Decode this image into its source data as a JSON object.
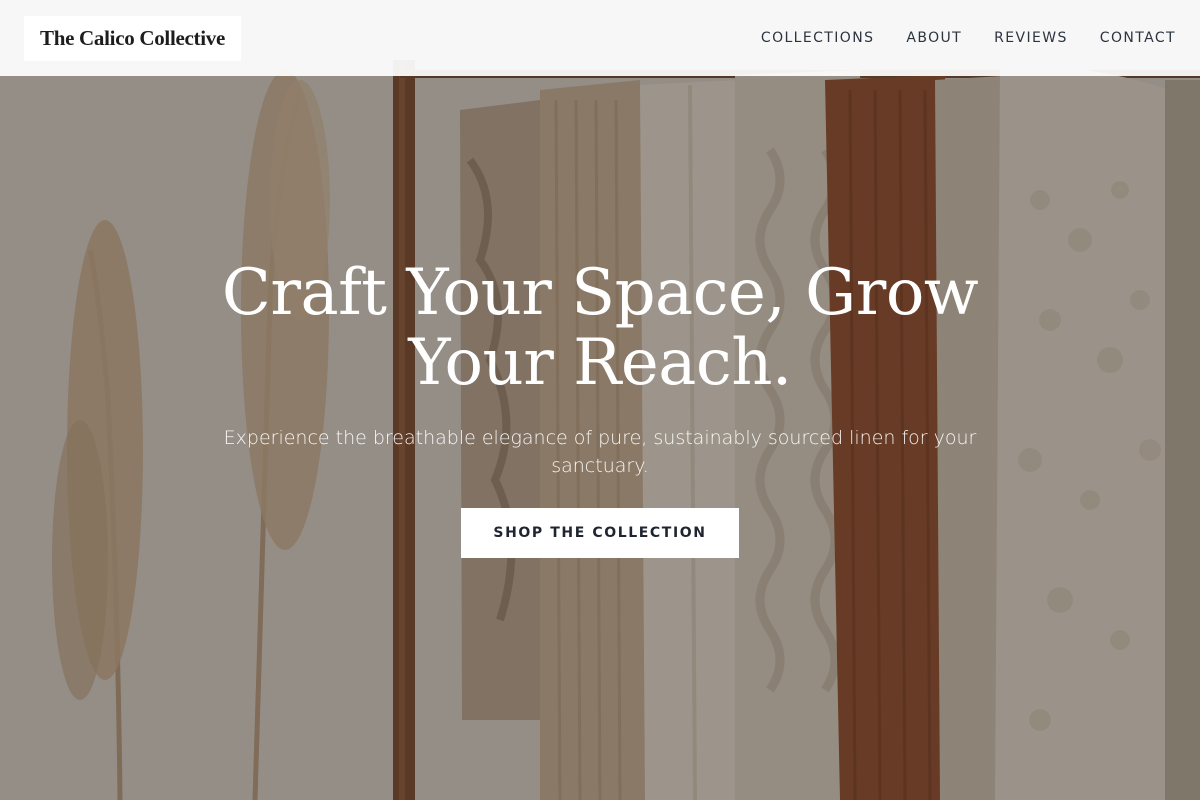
{
  "brand": {
    "name": "The Calico Collective"
  },
  "nav": {
    "items": [
      {
        "label": "COLLECTIONS"
      },
      {
        "label": "ABOUT"
      },
      {
        "label": "REVIEWS"
      },
      {
        "label": "CONTACT"
      }
    ]
  },
  "hero": {
    "title": "Craft Your Space, Grow Your Reach.",
    "subtitle": "Experience the breathable elegance of pure, sustainably sourced linen for your sanctuary.",
    "cta_label": "SHOP THE COLLECTION",
    "background_image": "clothing-rack-with-pampas-grass-photo"
  },
  "colors": {
    "header_bg": "#ffffff",
    "nav_text": "#2c3440",
    "hero_text": "#ffffff",
    "cta_bg": "#ffffff",
    "cta_text": "#1f2530"
  }
}
